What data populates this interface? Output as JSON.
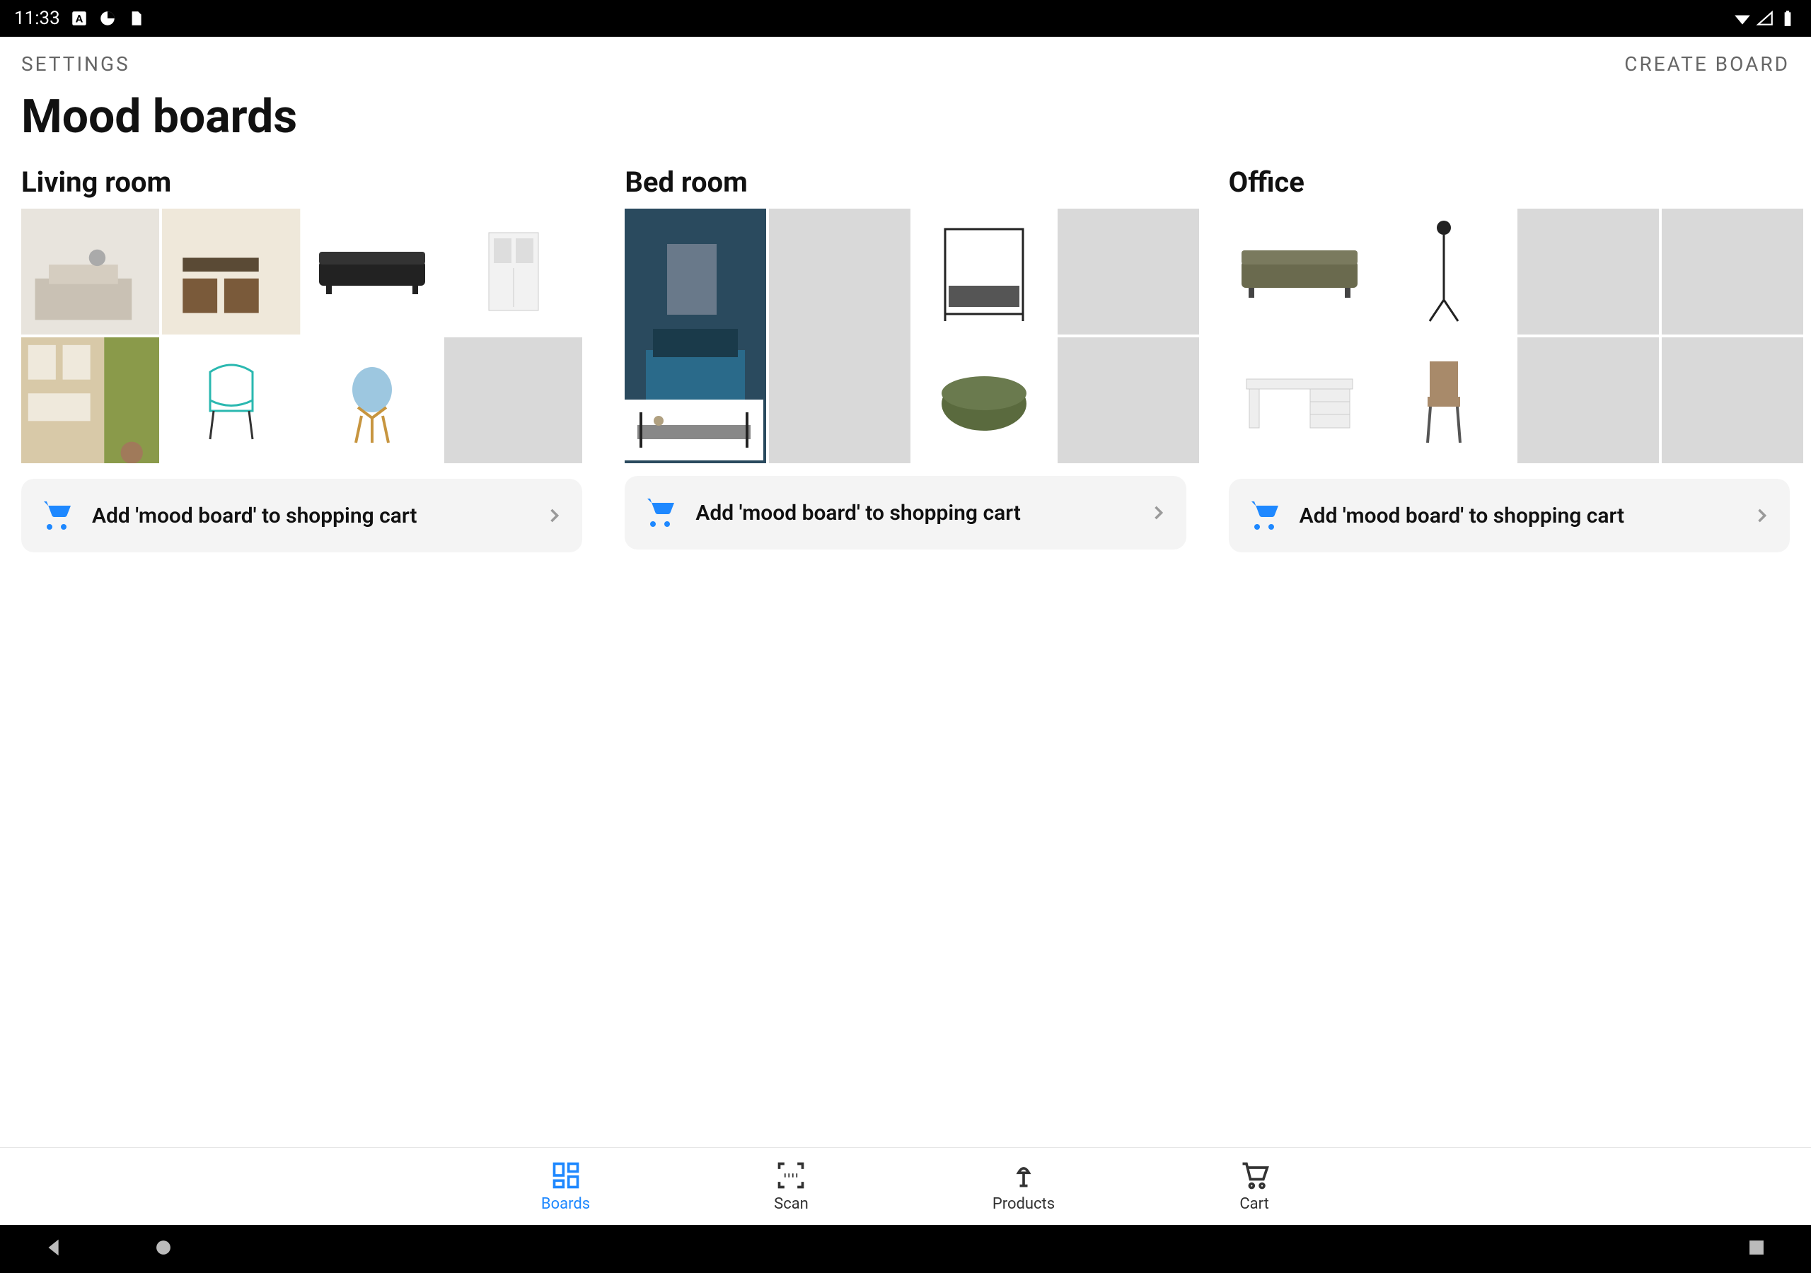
{
  "status": {
    "time": "11:33"
  },
  "header": {
    "settings": "SETTINGS",
    "create": "CREATE BOARD"
  },
  "page_title": "Mood boards",
  "boards": [
    {
      "title": "Living room",
      "add_label": "Add 'mood board' to shopping cart",
      "tiles": [
        {
          "name": "living-room-photo-1",
          "placeholder": false
        },
        {
          "name": "living-room-photo-2",
          "placeholder": false
        },
        {
          "name": "sofa-black",
          "placeholder": false
        },
        {
          "name": "cabinet-white",
          "placeholder": false
        },
        {
          "name": "shelf-unit",
          "placeholder": false
        },
        {
          "name": "chair-teal",
          "placeholder": false
        },
        {
          "name": "chair-blue-legs",
          "placeholder": false
        },
        {
          "name": "empty",
          "placeholder": true
        }
      ]
    },
    {
      "title": "Bed room",
      "add_label": "Add 'mood board' to shopping cart",
      "tiles": [
        {
          "name": "bedroom-photo",
          "placeholder": false,
          "big": true
        },
        {
          "name": "canopy-bed",
          "placeholder": false
        },
        {
          "name": "empty",
          "placeholder": true
        },
        {
          "name": "empty",
          "placeholder": true
        },
        {
          "name": "daybed",
          "placeholder": false
        },
        {
          "name": "ottoman-green",
          "placeholder": false
        },
        {
          "name": "empty",
          "placeholder": true
        },
        {
          "name": "empty",
          "placeholder": true
        }
      ]
    },
    {
      "title": "Office",
      "add_label": "Add 'mood board' to shopping cart",
      "tiles": [
        {
          "name": "sofa-olive",
          "placeholder": false
        },
        {
          "name": "floor-lamp",
          "placeholder": false
        },
        {
          "name": "empty",
          "placeholder": true
        },
        {
          "name": "empty",
          "placeholder": true
        },
        {
          "name": "desk-white",
          "placeholder": false
        },
        {
          "name": "chair-wood",
          "placeholder": false
        },
        {
          "name": "empty",
          "placeholder": true
        },
        {
          "name": "empty",
          "placeholder": true
        }
      ]
    }
  ],
  "tabs": [
    {
      "id": "boards",
      "label": "Boards",
      "active": true
    },
    {
      "id": "scan",
      "label": "Scan",
      "active": false
    },
    {
      "id": "products",
      "label": "Products",
      "active": false
    },
    {
      "id": "cart",
      "label": "Cart",
      "active": false
    }
  ],
  "colors": {
    "accent": "#1e88ff",
    "muted": "#666",
    "tile_placeholder": "#d9d9d9",
    "chip_bg": "#f4f4f4"
  }
}
